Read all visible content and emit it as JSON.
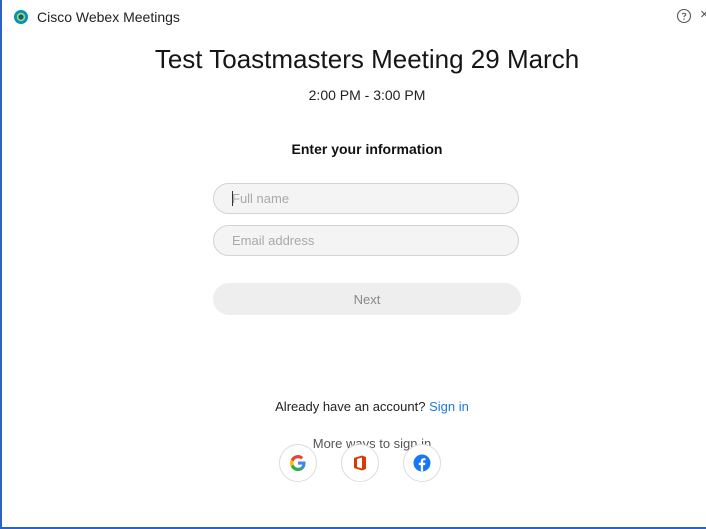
{
  "window": {
    "title": "Cisco Webex Meetings",
    "help_icon": "help-circle-icon",
    "close_icon": "close-icon",
    "close_glyph": "×"
  },
  "meeting": {
    "title": "Test Toastmasters Meeting 29 March",
    "time": "2:00 PM - 3:00 PM"
  },
  "form": {
    "heading": "Enter your information",
    "full_name_placeholder": "Full name",
    "email_placeholder": "Email address",
    "next_label": "Next"
  },
  "signin": {
    "prompt": "Already have an account?",
    "link_label": "Sign in",
    "more_ways": "More ways to sign in",
    "providers": [
      "google-icon",
      "office-icon",
      "facebook-icon"
    ]
  },
  "colors": {
    "window_border": "#2b63c6",
    "link": "#1f7ad8",
    "google_blue": "#4285F4",
    "google_red": "#EA4335",
    "google_yellow": "#FBBC05",
    "google_green": "#34A853",
    "office_orange": "#D83B01",
    "facebook_blue": "#1877F2"
  }
}
